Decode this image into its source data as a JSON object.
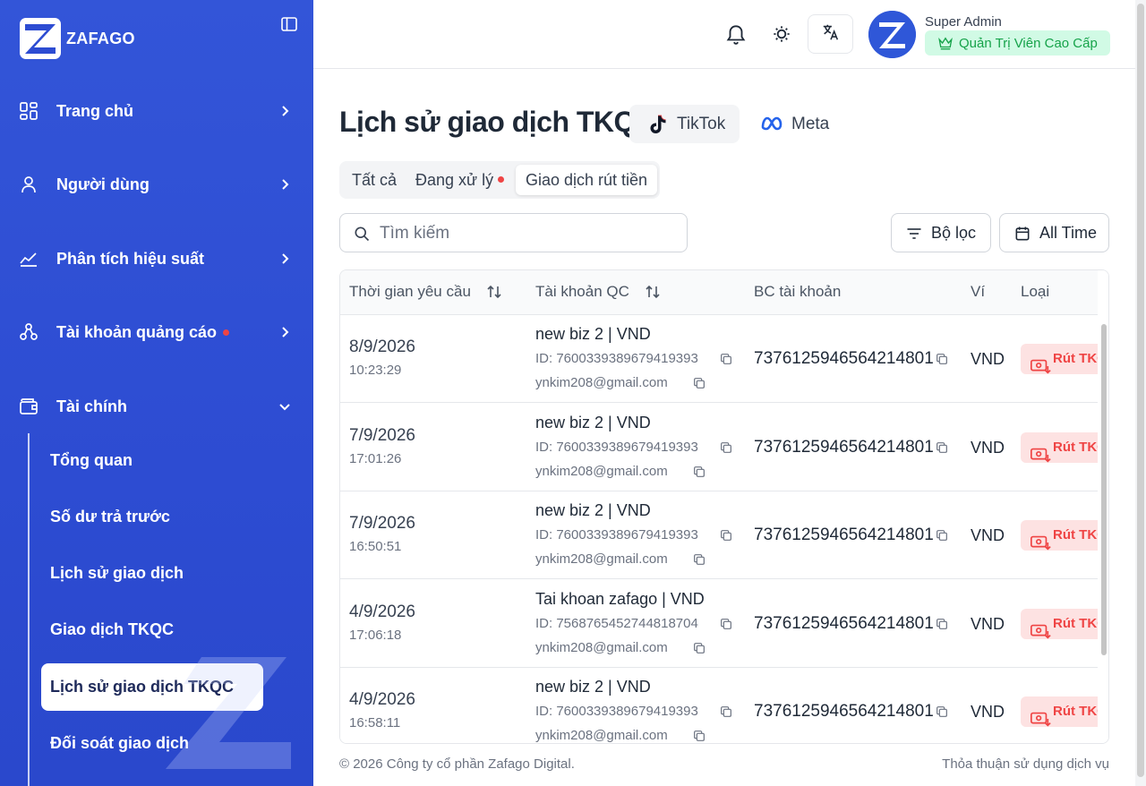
{
  "brand": {
    "name": "ZAFAGO",
    "accent": "#2d4cd2"
  },
  "sidebar": {
    "items": [
      {
        "label": "Trang chủ",
        "icon": "dashboard-icon",
        "expanded": false
      },
      {
        "label": "Người dùng",
        "icon": "user-icon",
        "expanded": false
      },
      {
        "label": "Phân tích hiệu suất",
        "icon": "chart-line-icon",
        "expanded": false
      },
      {
        "label": "Tài khoản quảng cáo",
        "icon": "accounts-icon",
        "expanded": false,
        "dot": true
      },
      {
        "label": "Tài chính",
        "icon": "wallet-icon",
        "expanded": true
      }
    ],
    "sub_items": [
      {
        "label": "Tổng quan"
      },
      {
        "label": "Số dư trả trước"
      },
      {
        "label": "Lịch sử giao dịch"
      },
      {
        "label": "Giao dịch TKQC"
      },
      {
        "label": "Lịch sử giao dịch TKQC",
        "active": true
      },
      {
        "label": "Đối soát giao dịch"
      }
    ]
  },
  "header": {
    "user_name": "Super Admin",
    "role": "Quản Trị Viên Cao Cấp",
    "icons": [
      "bell-icon",
      "sun-icon",
      "translate-icon"
    ]
  },
  "main": {
    "title": "Lịch sử giao dịch TKQC",
    "platforms": [
      {
        "label": "TikTok",
        "active": true
      },
      {
        "label": "Meta",
        "active": false
      }
    ],
    "status_tabs": [
      {
        "label": "Tất cả",
        "active": false
      },
      {
        "label": "Đang xử lý",
        "active": false,
        "dot": true
      },
      {
        "label": "Giao dịch rút tiền",
        "active": true
      }
    ],
    "search": {
      "placeholder": "Tìm kiếm",
      "value": ""
    },
    "filter_label": "Bộ lọc",
    "time_label": "All Time"
  },
  "table": {
    "columns": [
      "Thời gian yêu cầu",
      "Tài khoản QC",
      "BC tài khoản",
      "Ví",
      "Loại"
    ],
    "rows": [
      {
        "date": "8/9/2026",
        "time": "10:23:29",
        "account": "new biz 2 | VND",
        "id": "ID: 7600339389679419393",
        "email": "ynkim208@gmail.com",
        "bc": "7376125946564214801",
        "wallet": "VND",
        "type": "Rút TKQC"
      },
      {
        "date": "7/9/2026",
        "time": "17:01:26",
        "account": "new biz 2 | VND",
        "id": "ID: 7600339389679419393",
        "email": "ynkim208@gmail.com",
        "bc": "7376125946564214801",
        "wallet": "VND",
        "type": "Rút TKQC"
      },
      {
        "date": "7/9/2026",
        "time": "16:50:51",
        "account": "new biz 2 | VND",
        "id": "ID: 7600339389679419393",
        "email": "ynkim208@gmail.com",
        "bc": "7376125946564214801",
        "wallet": "VND",
        "type": "Rút TKQC"
      },
      {
        "date": "4/9/2026",
        "time": "17:06:18",
        "account": "Tai khoan zafago | VND",
        "id": "ID: 7568765452744818704",
        "email": "ynkim208@gmail.com",
        "bc": "7376125946564214801",
        "wallet": "VND",
        "type": "Rút TKQC"
      },
      {
        "date": "4/9/2026",
        "time": "16:58:11",
        "account": "new biz 2 | VND",
        "id": "ID: 7600339389679419393",
        "email": "ynkim208@gmail.com",
        "bc": "7376125946564214801",
        "wallet": "VND",
        "type": "Rút TKQC"
      }
    ]
  },
  "footer": {
    "copyright": "© 2026 Công ty cổ phần Zafago Digital.",
    "terms": "Thỏa thuận sử dụng dịch vụ"
  }
}
